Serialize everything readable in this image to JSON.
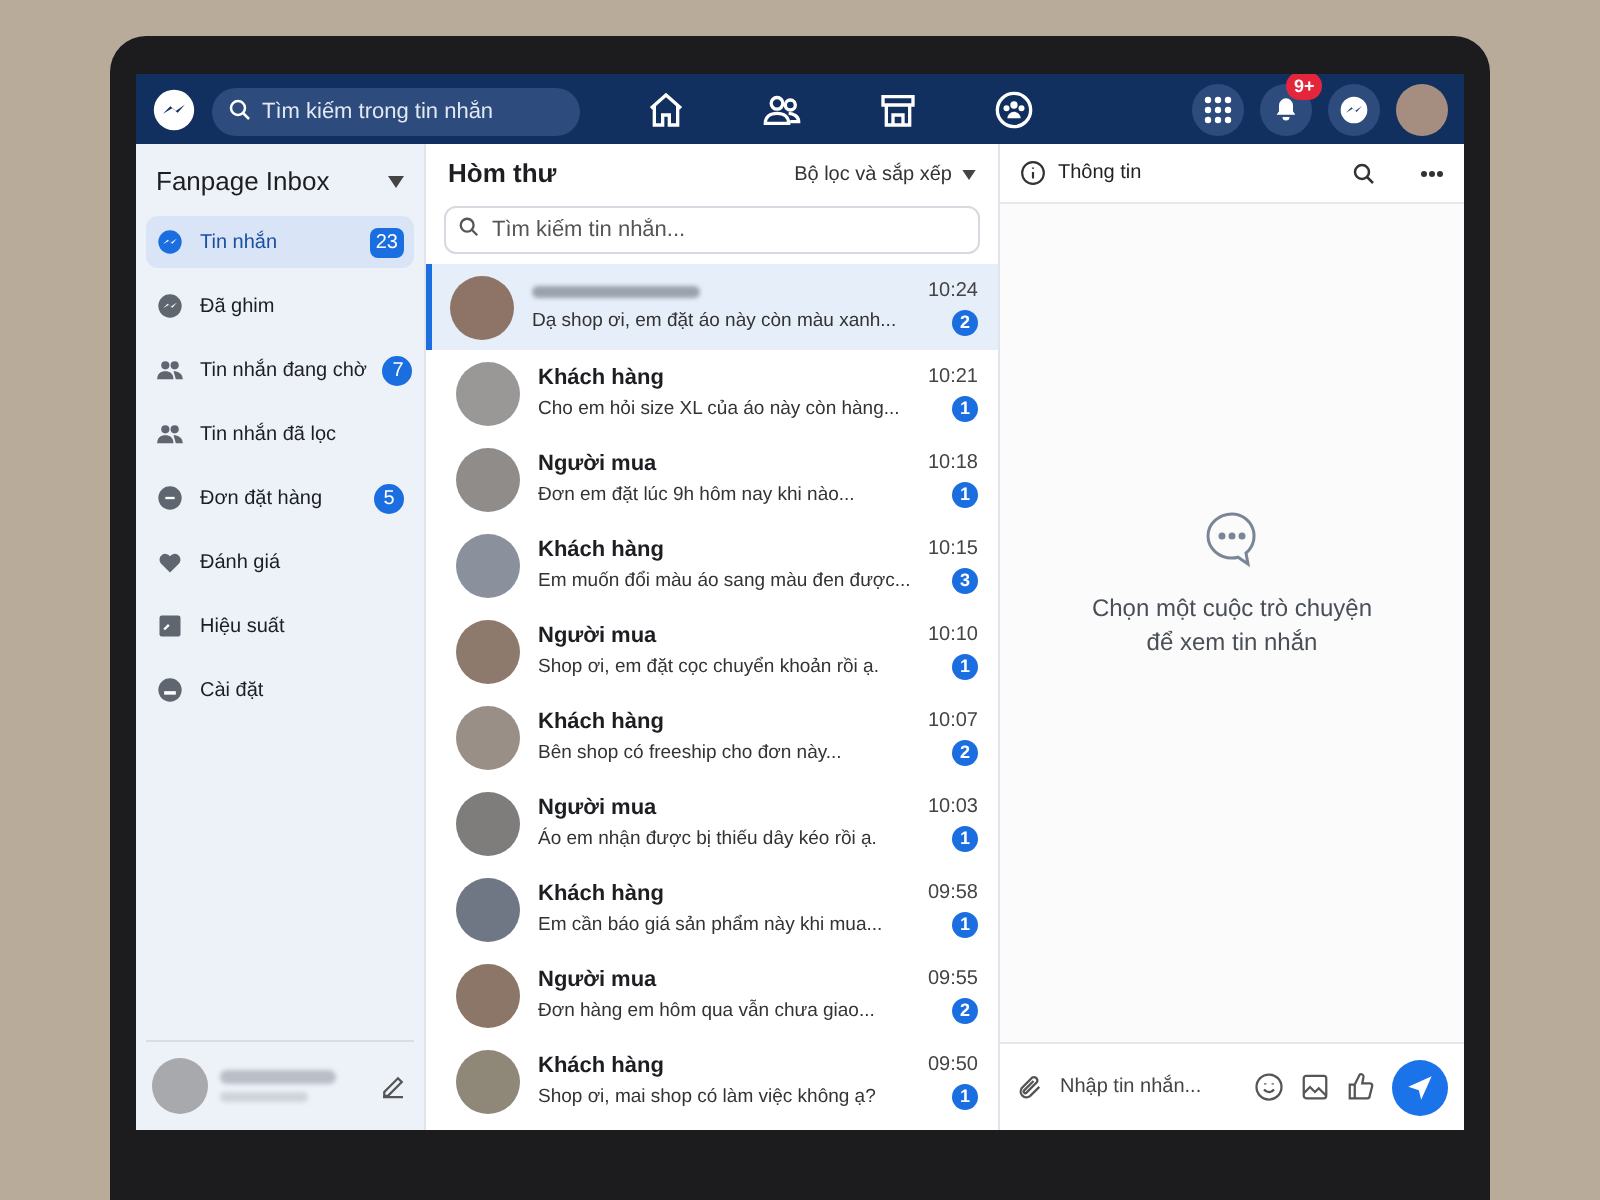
{
  "top_bar": {
    "search": {
      "placeholder": "Tìm kiếm trong tin nhắn"
    },
    "nav_tabs": [
      {
        "selected": false
      },
      {
        "selected": false
      },
      {
        "selected": false
      },
      {
        "selected": false
      }
    ],
    "notification_badge": "9+"
  },
  "sidebar": {
    "title": "Fanpage Inbox",
    "items": [
      {
        "label": "Tin nhắn",
        "selected": true,
        "count": "23"
      },
      {
        "label": "Đã ghim",
        "selected": false
      },
      {
        "label": "Tin nhắn đang chờ",
        "selected": false,
        "count": "7"
      },
      {
        "label": "Tin nhắn đã lọc",
        "selected": false
      },
      {
        "label": "Đơn đặt hàng",
        "selected": false,
        "count": "5"
      },
      {
        "label": "Đánh giá",
        "selected": false
      },
      {
        "label": "Hiệu suất",
        "selected": false
      },
      {
        "label": "Cài đặt",
        "selected": false
      }
    ]
  },
  "inbox": {
    "title": "Hòm thư",
    "filter": "Bộ lọc và sắp xếp",
    "search": {
      "placeholder": "Tìm kiếm tin nhắn..."
    },
    "conversations": [
      {
        "name_blurred": true,
        "preview": "Dạ shop ơi, em đặt áo này còn màu xanh...",
        "time": "10:24",
        "unread": "2",
        "selected": true
      },
      {
        "name": "Khách hàng",
        "preview": "Cho em hỏi size XL của áo này còn hàng...",
        "time": "10:21",
        "unread": "1",
        "selected": false
      },
      {
        "name": "Người mua",
        "preview": "Đơn em đặt lúc 9h hôm nay khi nào...",
        "time": "10:18",
        "unread": "1",
        "selected": false
      },
      {
        "name": "Khách hàng",
        "preview": "Em muốn đổi màu áo sang màu đen được...",
        "time": "10:15",
        "unread": "3",
        "selected": false
      },
      {
        "name": "Người mua",
        "preview": "Shop ơi, em đặt cọc chuyển khoản rồi ạ.",
        "time": "10:10",
        "unread": "1",
        "selected": false
      },
      {
        "name": "Khách hàng",
        "preview": "Bên shop có freeship cho đơn này...",
        "time": "10:07",
        "unread": "2",
        "selected": false
      },
      {
        "name": "Người mua",
        "preview": "Áo em nhận được bị thiếu dây kéo rồi ạ.",
        "time": "10:03",
        "unread": "1",
        "selected": false
      },
      {
        "name": "Khách hàng",
        "preview": "Em cần báo giá sản phẩm này khi mua...",
        "time": "09:58",
        "unread": "1",
        "selected": false
      },
      {
        "name": "Người mua",
        "preview": "Đơn hàng em hôm qua vẫn chưa giao...",
        "time": "09:55",
        "unread": "2",
        "selected": false
      },
      {
        "name": "Khách hàng",
        "preview": "Shop ơi, mai shop có làm việc không ạ?",
        "time": "09:50",
        "unread": "1",
        "selected": false
      }
    ]
  },
  "detail": {
    "header": "Thông tin",
    "empty_state": "Chọn một cuộc trò chuyện\nđể xem tin nhắn",
    "composer": {
      "placeholder": "Nhập tin nhắn..."
    }
  }
}
